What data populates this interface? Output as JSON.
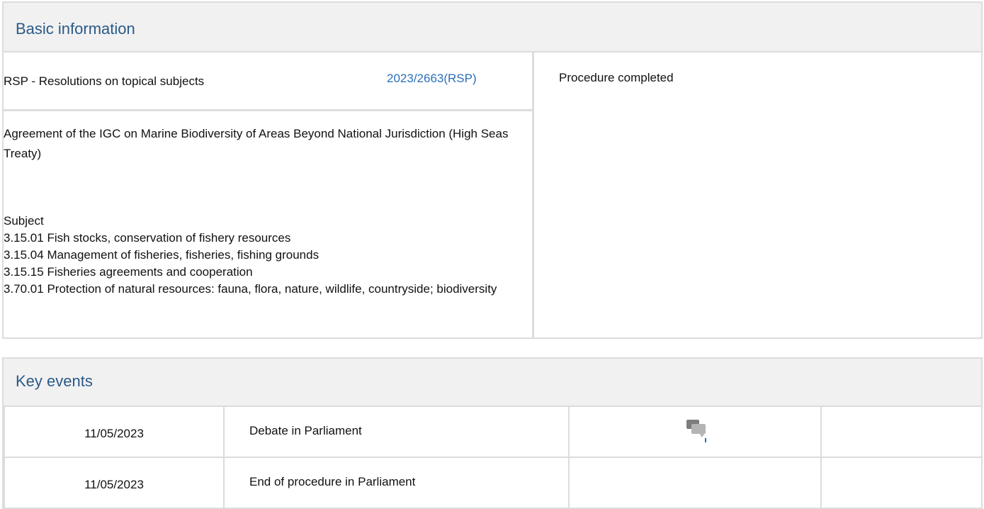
{
  "basic_information": {
    "heading": "Basic information",
    "procedure_type": "RSP - Resolutions on topical subjects",
    "reference": "2023/2663(RSP)",
    "title": "Agreement of the IGC on Marine Biodiversity of Areas Beyond National Jurisdiction (High Seas Treaty)",
    "subject_heading": "Subject",
    "subjects": [
      "3.15.01 Fish stocks, conservation of fishery resources",
      "3.15.04 Management of fisheries, fisheries, fishing grounds",
      "3.15.15 Fisheries agreements and cooperation",
      "3.70.01 Protection of natural resources: fauna, flora, nature, wildlife, countryside; biodiversity"
    ],
    "status": "Procedure completed"
  },
  "key_events": {
    "heading": "Key events",
    "rows": [
      {
        "date": "11/05/2023",
        "event": "Debate in Parliament",
        "icon": "debate-icon"
      },
      {
        "date": "11/05/2023",
        "event": "End of procedure in Parliament",
        "icon": ""
      }
    ]
  },
  "colors": {
    "heading_text": "#2a5a8a",
    "link": "#2a6fb8",
    "border": "#dcdcdc",
    "header_bg": "#f1f1f1"
  }
}
